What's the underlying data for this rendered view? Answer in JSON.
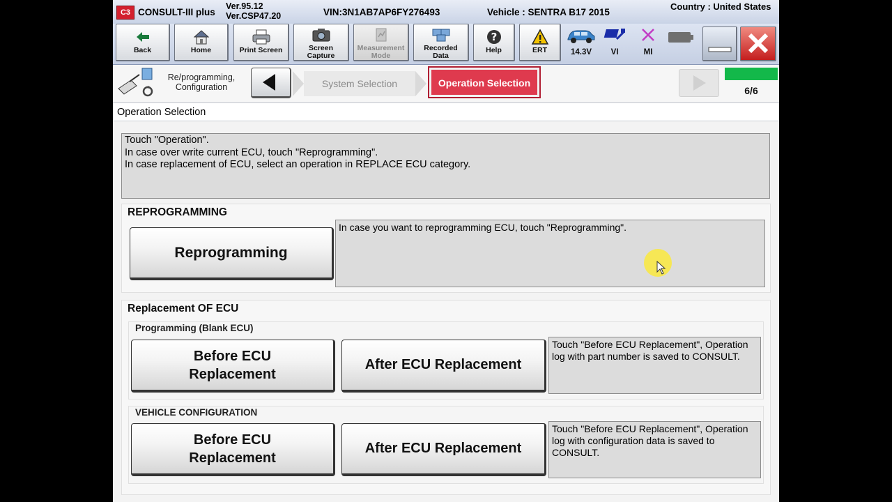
{
  "app": {
    "name": "CONSULT-III plus",
    "logo_text": "C3",
    "version_1": "Ver.95.12",
    "version_2": "Ver.CSP47.20",
    "vin": "VIN:3N1AB7AP6FY276493",
    "vehicle": "Vehicle : SENTRA B17 2015",
    "country": "Country : United States"
  },
  "toolbar": {
    "back": "Back",
    "home": "Home",
    "print_screen": "Print Screen",
    "screen_capture_1": "Screen",
    "screen_capture_2": "Capture",
    "measurement_1": "Measurement",
    "measurement_2": "Mode",
    "recorded_1": "Recorded",
    "recorded_2": "Data",
    "help": "Help",
    "ert": "ERT",
    "voltage": "14.3V",
    "vi": "VI",
    "mi": "MI"
  },
  "breadcrumb": {
    "reprog_line1": "Re/programming,",
    "reprog_line2": "Configuration",
    "step1": "System Selection",
    "step2": "Operation Selection",
    "progress": "6/6",
    "progress_fraction": 1.0
  },
  "section_title": "Operation Selection",
  "instructions": [
    "Touch \"Operation\".",
    "In case over write current ECU, touch \"Reprogramming\".",
    "In case replacement of ECU, select an operation in REPLACE ECU category."
  ],
  "reprogramming": {
    "title": "REPROGRAMMING",
    "button": "Reprogramming",
    "desc": "In case you want to reprogramming ECU, touch \"Reprogramming\"."
  },
  "replacement": {
    "title": "Replacement OF ECU",
    "blank": {
      "title": "Programming (Blank ECU)",
      "before_1": "Before ECU",
      "before_2": "Replacement",
      "after": "After ECU Replacement",
      "desc": "Touch \"Before ECU Replacement\", Operation log with part number is saved to CONSULT."
    },
    "config": {
      "title": "VEHICLE CONFIGURATION",
      "before_1": "Before ECU",
      "before_2": "Replacement",
      "after": "After ECU Replacement",
      "desc": "Touch \"Before ECU Replacement\", Operation log with configuration data is saved to CONSULT."
    }
  }
}
